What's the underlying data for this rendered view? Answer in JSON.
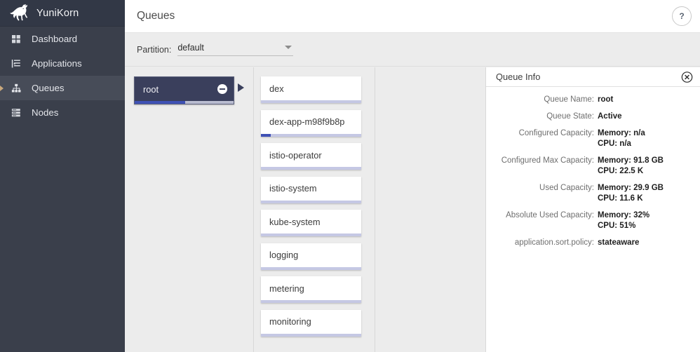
{
  "sidebar": {
    "brand": {
      "title": "YuniKorn",
      "logo_icon": "unicorn-icon"
    },
    "items": [
      {
        "label": "Dashboard",
        "icon": "dashboard-grid-icon",
        "active": false
      },
      {
        "label": "Applications",
        "icon": "applications-list-icon",
        "active": false
      },
      {
        "label": "Queues",
        "icon": "queues-hierarchy-icon",
        "active": true
      },
      {
        "label": "Nodes",
        "icon": "nodes-stack-icon",
        "active": false
      }
    ]
  },
  "header": {
    "title": "Queues",
    "help_label": "?",
    "help_icon": "question-mark-icon"
  },
  "partition": {
    "label": "Partition:",
    "value": "default",
    "options": [
      "default"
    ],
    "arrow_icon": "chevron-down-icon"
  },
  "queues": {
    "root": {
      "label": "root",
      "progress_percent": 51,
      "collapse_icon": "minus-circle-icon",
      "expand_icon": "triangle-right-icon"
    },
    "children": [
      {
        "label": "dex",
        "progress_percent": 0
      },
      {
        "label": "dex-app-m98f9b8p",
        "progress_percent": 10
      },
      {
        "label": "istio-operator",
        "progress_percent": 0
      },
      {
        "label": "istio-system",
        "progress_percent": 0
      },
      {
        "label": "kube-system",
        "progress_percent": 0
      },
      {
        "label": "logging",
        "progress_percent": 0
      },
      {
        "label": "metering",
        "progress_percent": 0
      },
      {
        "label": "monitoring",
        "progress_percent": 0
      }
    ]
  },
  "queue_info": {
    "title": "Queue Info",
    "close_icon": "close-circle-icon",
    "rows": [
      {
        "label": "Queue Name:",
        "value": "root",
        "value2": ""
      },
      {
        "label": "Queue State:",
        "value": "Active",
        "value2": ""
      },
      {
        "label": "Configured Capacity:",
        "value": "Memory: n/a",
        "value2": "CPU: n/a"
      },
      {
        "label": "Configured Max Capacity:",
        "value": "Memory: 91.8 GB",
        "value2": "CPU: 22.5 K"
      },
      {
        "label": "Used Capacity:",
        "value": "Memory: 29.9 GB",
        "value2": "CPU: 11.6 K"
      },
      {
        "label": "Absolute Used Capacity:",
        "value": "Memory: 32%",
        "value2": "CPU: 51%"
      },
      {
        "label": "application.sort.policy:",
        "value": "stateaware",
        "value2": ""
      }
    ]
  },
  "colors": {
    "sidebar_bg": "#3a3f4b",
    "brand_bg": "#323846",
    "accent_blue": "#3f51b5",
    "bar_track": "#c5c8e4",
    "root_card": "#3a3f5c",
    "page_bg": "#ececec"
  }
}
